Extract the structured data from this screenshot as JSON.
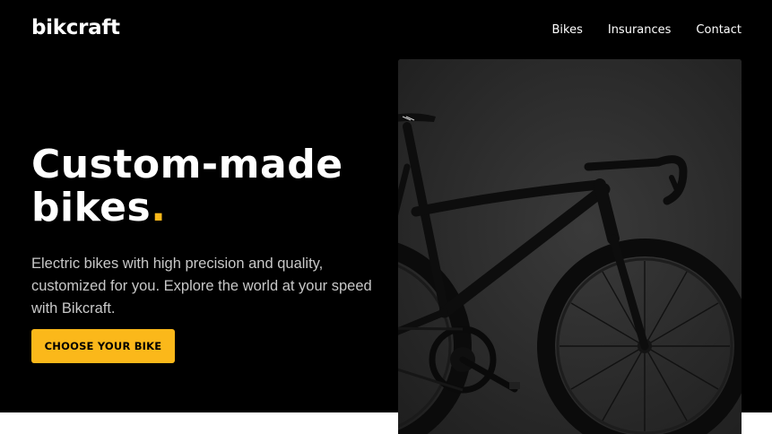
{
  "header": {
    "logo": "bikcraft",
    "nav": [
      {
        "label": "Bikes"
      },
      {
        "label": "Insurances"
      },
      {
        "label": "Contact"
      }
    ]
  },
  "hero": {
    "headline_line1": "Custom-made",
    "headline_line2": "bikes",
    "headline_dot": ".",
    "description": "Electric bikes with high precision and quality, customized for you. Explore the world at your speed with Bikcraft.",
    "cta_label": "CHOOSE YOUR BIKE",
    "image_subject": "black road bike on dark background"
  },
  "colors": {
    "background": "#000000",
    "accent": "#fbb81a",
    "text": "#ffffff",
    "muted_text": "#c8c8c8"
  }
}
